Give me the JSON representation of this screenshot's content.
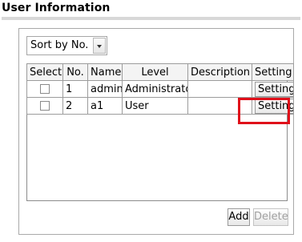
{
  "section": {
    "title": "User Information"
  },
  "sort": {
    "selected": "Sort by No."
  },
  "table": {
    "headers": [
      "Select",
      "No.",
      "Name",
      "Level",
      "Description",
      "Setting"
    ],
    "rows": [
      {
        "no": "1",
        "name": "admin",
        "level": "Administrator",
        "description": "",
        "setting": "Setting"
      },
      {
        "no": "2",
        "name": "a1",
        "level": "User",
        "description": "",
        "setting": "Setting"
      }
    ]
  },
  "actions": {
    "add": "Add",
    "delete": "Delete"
  },
  "colors": {
    "highlight": "#e0101a"
  }
}
